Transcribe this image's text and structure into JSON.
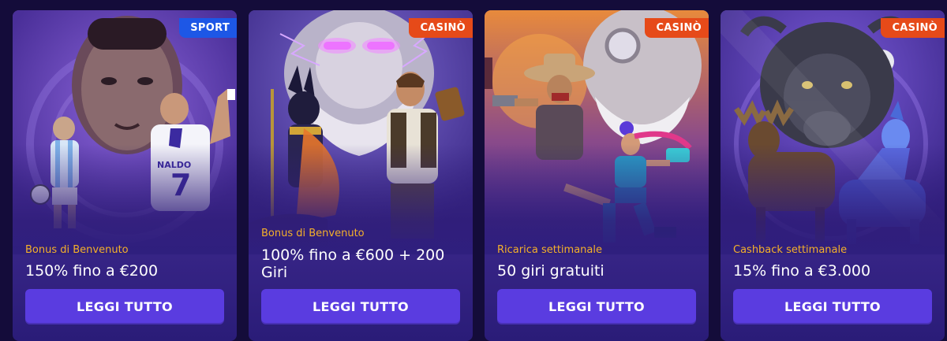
{
  "cards": [
    {
      "badge": "SPORT",
      "subtitle": "Bonus di Benvenuto",
      "title": "150% fino a €200",
      "button": "LEGGI TUTTO",
      "art_alt": "football-players-art"
    },
    {
      "badge": "CASINÒ",
      "subtitle": "Bonus di Benvenuto",
      "title": "100% fino a €600 + 200 Giri",
      "button": "LEGGI TUTTO",
      "art_alt": "zeus-anubis-explorer-art"
    },
    {
      "badge": "CASINÒ",
      "subtitle": "Ricarica settimanale",
      "title": "50 giri gratuiti",
      "button": "LEGGI TUTTO",
      "art_alt": "cowboy-runner-art"
    },
    {
      "badge": "CASINÒ",
      "subtitle": "Cashback settimanale",
      "title": "15% fino a €3.000",
      "button": "LEGGI TUTTO",
      "art_alt": "bison-moose-wolf-art"
    }
  ],
  "colors": {
    "sport_badge": "#1d57e6",
    "casino_badge": "#e64a19",
    "subtitle": "#f5b02a",
    "button": "#5a3ce0"
  }
}
